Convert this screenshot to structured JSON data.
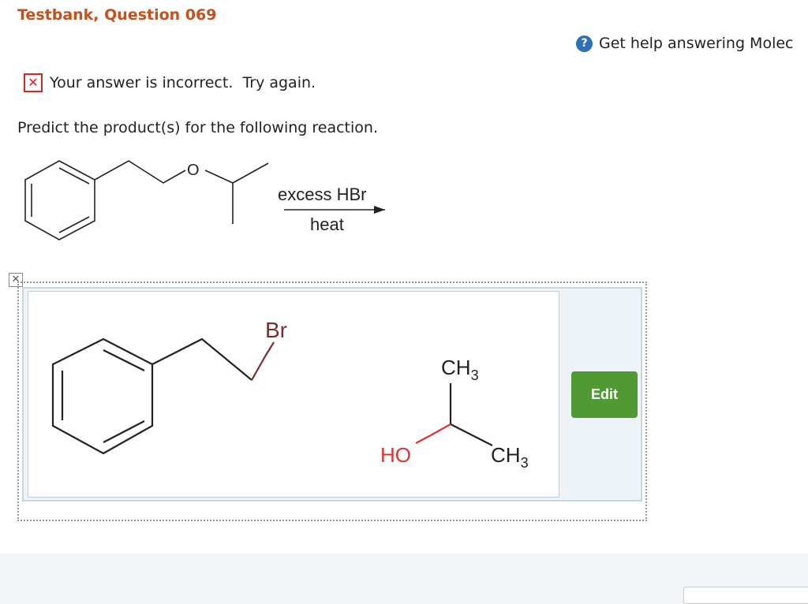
{
  "question": {
    "title": "Testbank, Question 069"
  },
  "help": {
    "icon": "question-circle-icon",
    "label": "Get help answering Molec"
  },
  "feedback": {
    "icon": "x-mark-icon",
    "message": "Your answer is incorrect.  Try again.",
    "color": "#dd2222"
  },
  "prompt": "Predict the product(s) for the following reaction.",
  "reaction": {
    "reactant_atom": "O",
    "reagent_above": "excess HBr",
    "reagent_below": "heat"
  },
  "answer": {
    "products": [
      {
        "atom": "Br"
      },
      {
        "labels": [
          "CH3",
          "HO",
          "CH3"
        ]
      }
    ],
    "label_hydroxyl": "HO",
    "label_methyl_top": "CH",
    "label_methyl_right": "CH",
    "subscript": "3",
    "edit_label": "Edit",
    "edit_color": "#4f9a32"
  }
}
